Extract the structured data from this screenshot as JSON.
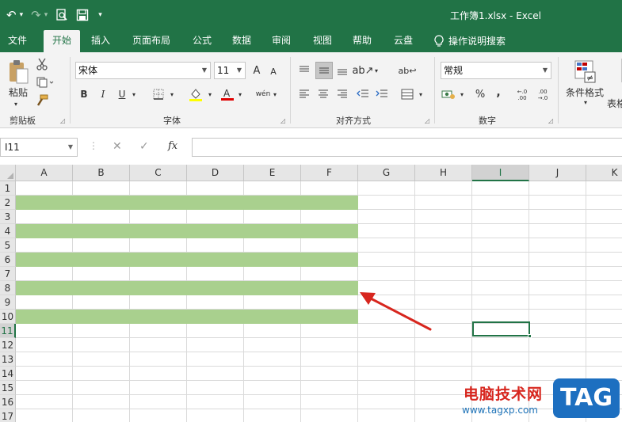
{
  "title_bar": {
    "doc_title": "工作簿1.xlsx  -  Excel",
    "undo_icon": "↶",
    "redo_icon": "↷",
    "print_preview_icon": "🔍",
    "save_icon": "💾",
    "customize_icon": "▾"
  },
  "tabs": [
    {
      "label": "文件"
    },
    {
      "label": "开始"
    },
    {
      "label": "插入"
    },
    {
      "label": "页面布局"
    },
    {
      "label": "公式"
    },
    {
      "label": "数据"
    },
    {
      "label": "审阅"
    },
    {
      "label": "视图"
    },
    {
      "label": "帮助"
    },
    {
      "label": "云盘"
    },
    {
      "label": "操作说明搜索"
    }
  ],
  "ribbon": {
    "clipboard": {
      "paste_label": "粘贴",
      "group_label": "剪贴板"
    },
    "font": {
      "font_name": "宋体",
      "font_size": "11",
      "grow_label": "A",
      "shrink_label": "A",
      "bold_label": "B",
      "italic_label": "I",
      "underline_label": "U",
      "phonetic_label": "wén",
      "group_label": "字体"
    },
    "alignment": {
      "group_label": "对齐方式"
    },
    "number": {
      "format": "常规",
      "percent_label": "%",
      "comma_label": ",",
      "inc_decimal_label": "←.0 .00",
      "dec_decimal_label": ".00 →.0",
      "group_label": "数字"
    },
    "styles": {
      "conditional_label": "条件格式",
      "table_label": "表格"
    }
  },
  "formula_bar": {
    "name_box": "I11",
    "cancel_icon": "✕",
    "enter_icon": "✓",
    "fx_label": "fx",
    "value": ""
  },
  "sheet": {
    "columns": [
      "A",
      "B",
      "C",
      "D",
      "E",
      "F",
      "G",
      "H",
      "I",
      "J",
      "K"
    ],
    "rows": [
      "1",
      "2",
      "3",
      "4",
      "5",
      "6",
      "7",
      "8",
      "9",
      "10",
      "11",
      "12",
      "13",
      "14",
      "15",
      "16",
      "17"
    ],
    "selected_column": "I",
    "selected_row": "11",
    "band_color": "#a9d08e",
    "banded_rows": [
      "2",
      "4",
      "6",
      "8",
      "10"
    ],
    "band_range": "A:F"
  },
  "annotation": {
    "arrow_color": "#d7261e"
  },
  "watermark": {
    "site_name": "电脑技术网",
    "url": "www.tagxp.com",
    "badge": "TAG"
  },
  "colors": {
    "excel_green": "#217346",
    "ribbon_bg": "#f3f3f3"
  }
}
